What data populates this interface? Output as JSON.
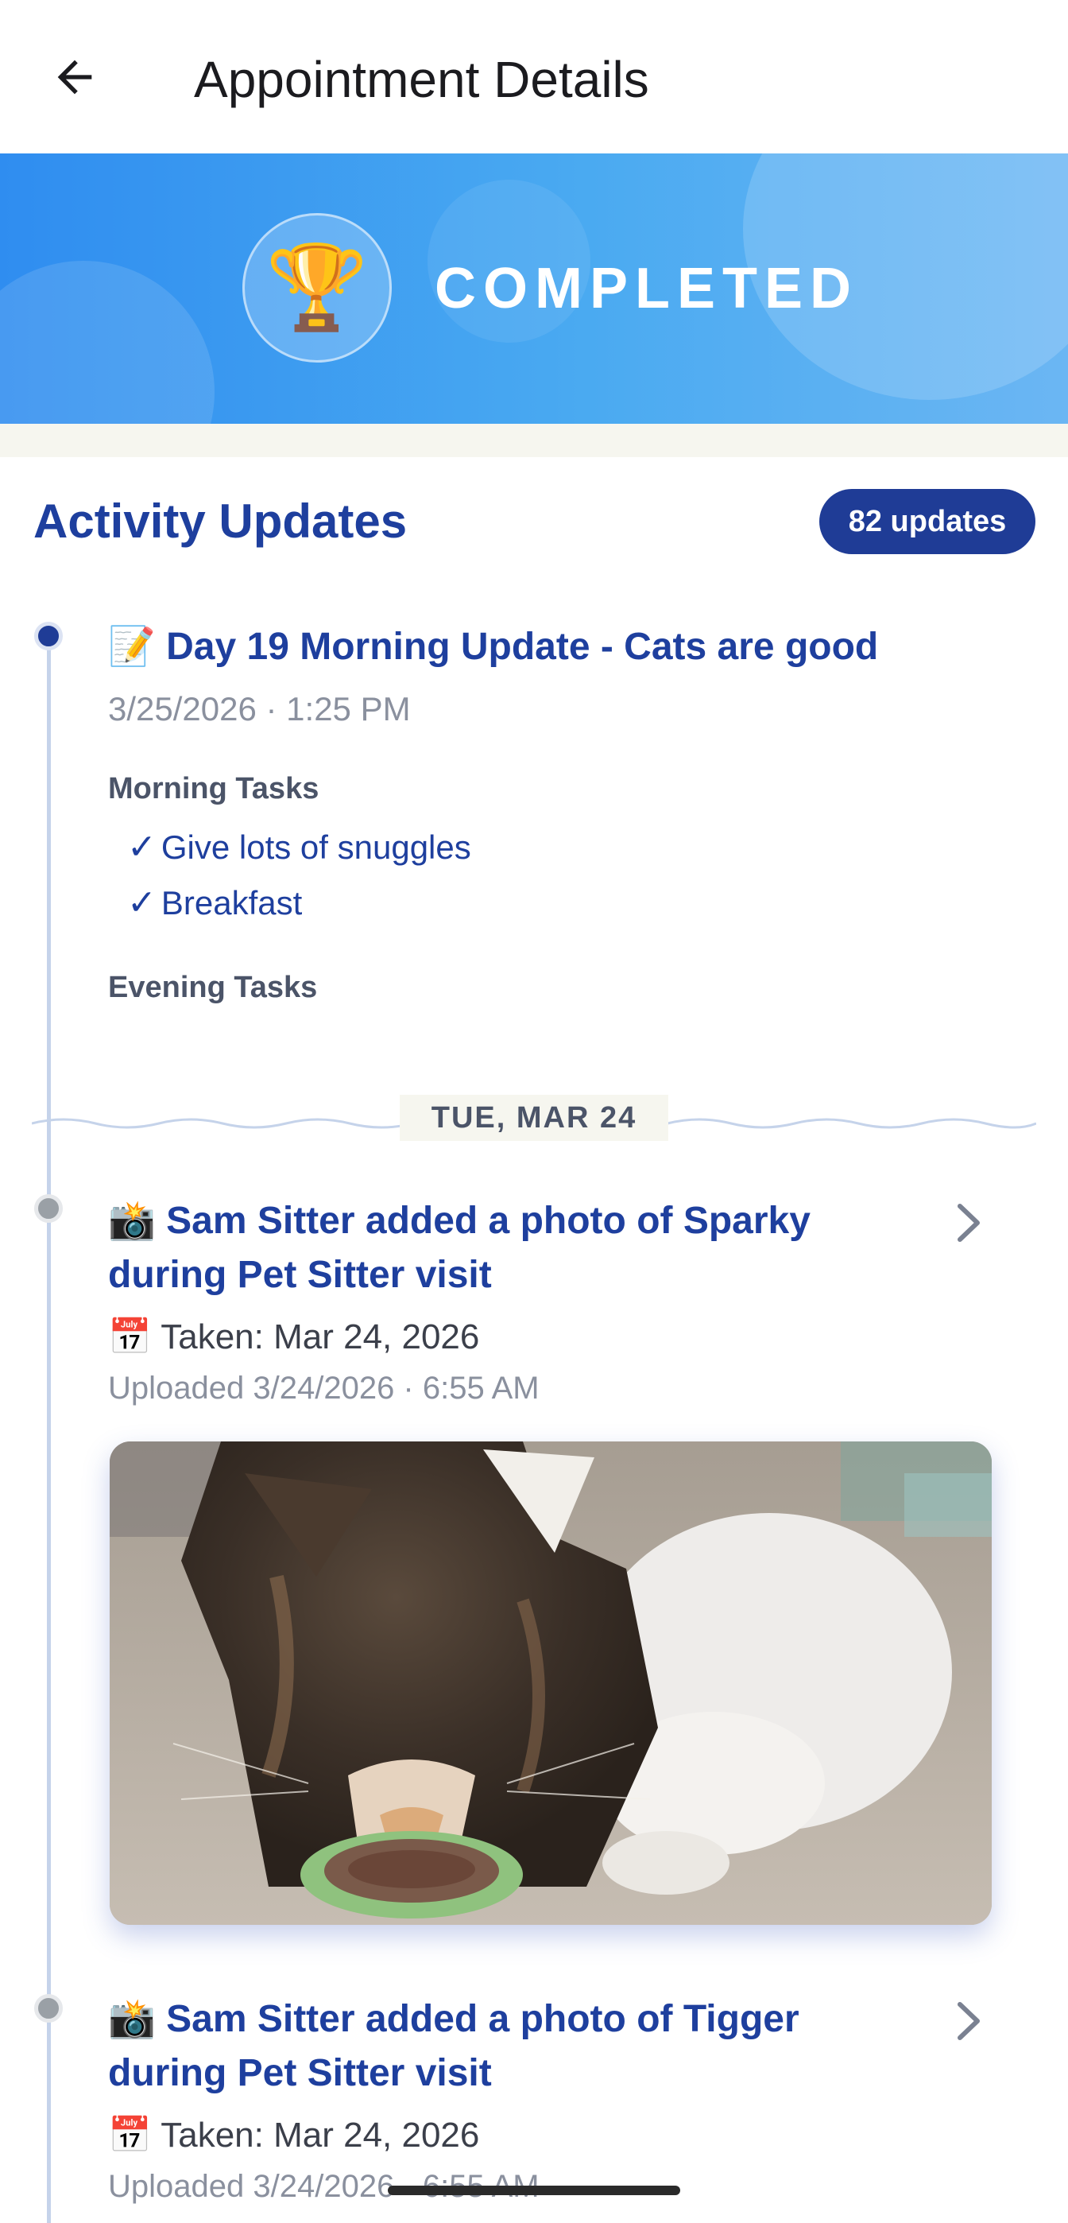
{
  "appbar": {
    "title": "Appointment Details",
    "back_icon": "arrow-left-icon"
  },
  "status_banner": {
    "icon": "trophy-icon",
    "icon_glyph": "🏆",
    "status": "COMPLETED",
    "colors": {
      "start": "#2f8df0",
      "end": "#6bb6f3"
    }
  },
  "activity": {
    "title": "Activity Updates",
    "count_label": "82 updates",
    "accent_color": "#1e3f9e",
    "entries": [
      {
        "emoji": "📝",
        "title": "Day 19 Morning Update - Cats are good",
        "timestamp": "3/25/2026 · 1:25 PM",
        "task_groups": [
          {
            "heading": "Morning Tasks",
            "tasks": [
              "Give lots of snuggles",
              "Breakfast"
            ],
            "check_glyph": "✓"
          },
          {
            "heading": "Evening Tasks",
            "tasks": []
          }
        ]
      }
    ],
    "date_separator": "TUE, MAR 24",
    "photo_entries": [
      {
        "emoji": "📸",
        "title": "Sam Sitter added a photo of Sparky during Pet Sitter visit",
        "taken_emoji": "📅",
        "taken": "Taken: Mar 24, 2026",
        "uploaded": "Uploaded 3/24/2026 · 6:55 AM",
        "photo_alt": "Sparky eating from a green bowl"
      },
      {
        "emoji": "📸",
        "title": "Sam Sitter added a photo of Tigger during Pet Sitter visit",
        "taken_emoji": "📅",
        "taken": "Taken: Mar 24, 2026",
        "uploaded": "Uploaded 3/24/2026 · 6:55 AM"
      }
    ]
  }
}
